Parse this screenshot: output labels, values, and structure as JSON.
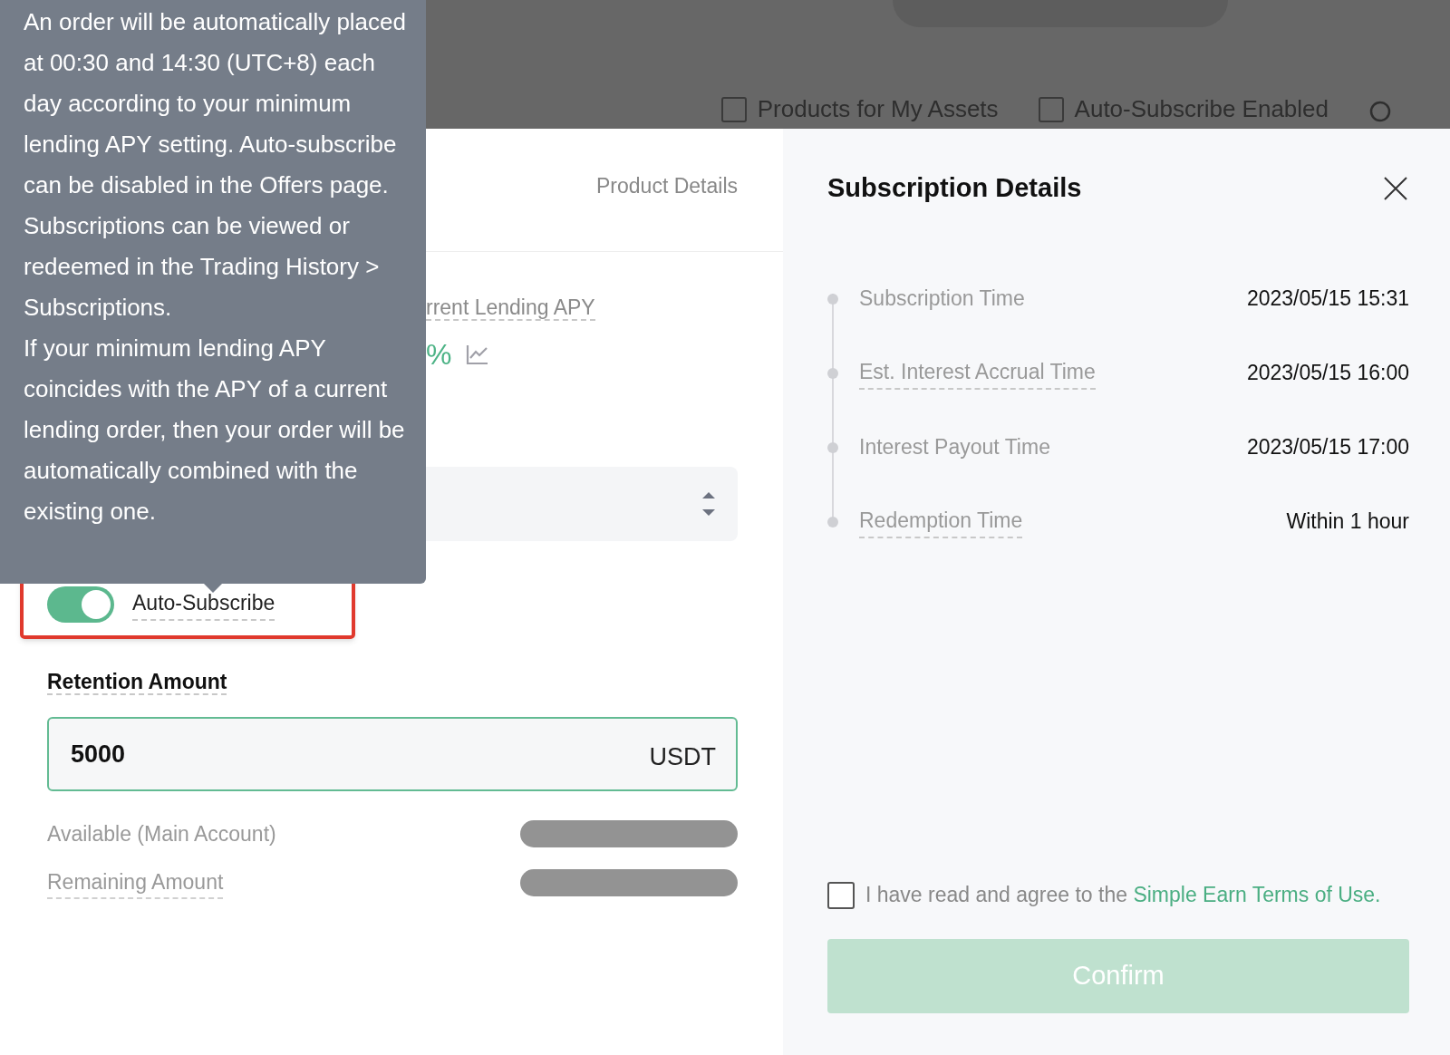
{
  "header": {
    "filters": [
      {
        "label": "Products for My Assets",
        "checked": false
      },
      {
        "label": "Auto-Subscribe Enabled",
        "checked": false
      }
    ]
  },
  "tooltip": {
    "paragraphs": [
      "An order will be automatically placed at 00:30 and 14:30 (UTC+8) each day according to your minimum lending APY setting. Auto-subscribe can be disabled in the Offers page. Subscriptions can be viewed or redeemed in the Trading History > Subscriptions.",
      "If your minimum lending APY coincides with the APY of a current lending order, then your order will be automatically combined with the existing one."
    ]
  },
  "product_panel": {
    "tabs": [
      {
        "label": "Product Details",
        "selected": false
      }
    ],
    "apy_label": "rrent Lending APY",
    "apy_value": "%",
    "auto_subscribe": {
      "label": "Auto-Subscribe",
      "on": true
    },
    "retention": {
      "label": "Retention Amount",
      "value": "5000",
      "unit": "USDT"
    },
    "balances": [
      {
        "label": "Available (Main Account)"
      },
      {
        "label": "Remaining Amount"
      }
    ]
  },
  "subscription": {
    "title": "Subscription Details",
    "timeline": [
      {
        "label": "Subscription Time",
        "value": "2023/05/15 15:31",
        "kind": "plain"
      },
      {
        "label": "Est. Interest Accrual Time",
        "value": "2023/05/15 16:00",
        "kind": "hint"
      },
      {
        "label": "Interest Payout Time",
        "value": "2023/05/15 17:00",
        "kind": "plain"
      },
      {
        "label": "Redemption Time",
        "value": "Within 1 hour",
        "kind": "hint"
      }
    ],
    "agreement": {
      "text": "I have read and agree to the ",
      "link": "Simple Earn Terms of Use.",
      "checked": false
    },
    "confirm": {
      "label": "Confirm",
      "disabled": true
    }
  }
}
